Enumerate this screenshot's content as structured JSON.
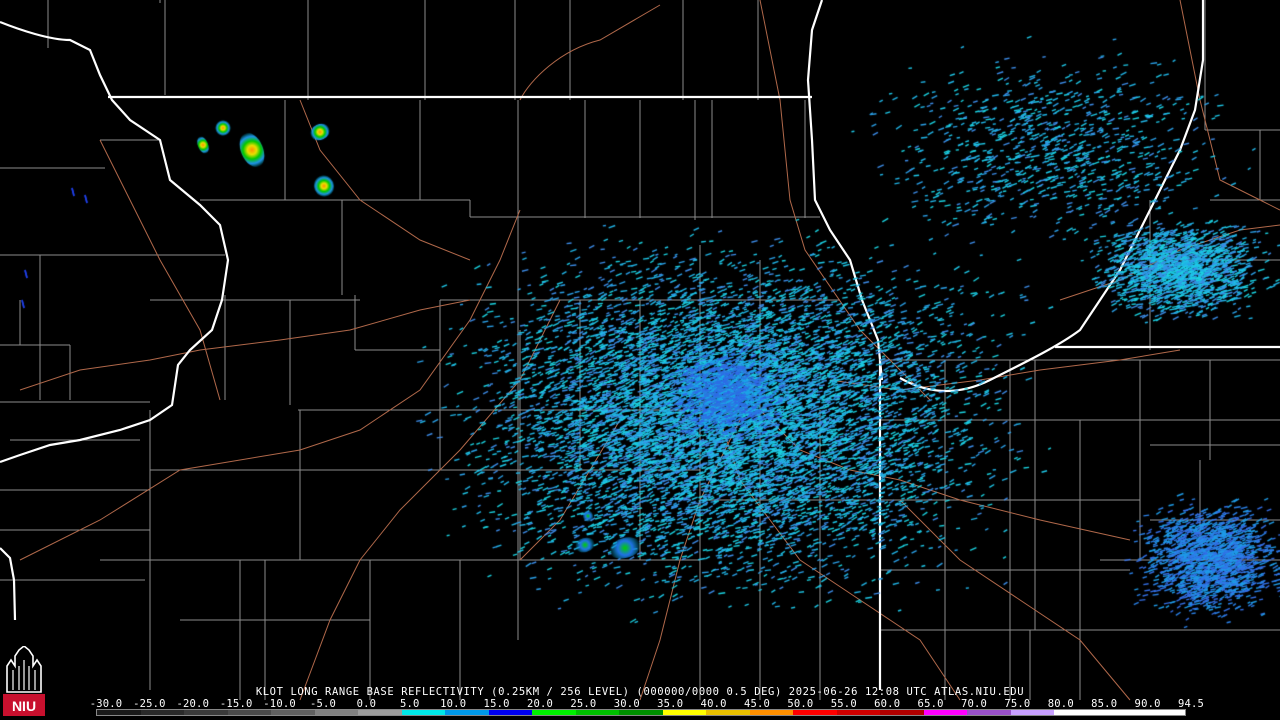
{
  "product": {
    "caption": "KLOT LONG RANGE BASE REFLECTIVITY (0.25KM / 256 LEVEL) (000000/0000 0.5 DEG) 2025-06-26 12:08 UTC  ATLAS.NIU.EDU"
  },
  "scale": {
    "labels": [
      "-30.0",
      "-25.0",
      "-20.0",
      "-15.0",
      "-10.0",
      "-5.0",
      "0.0",
      "5.0",
      "10.0",
      "15.0",
      "20.0",
      "25.0",
      "30.0",
      "35.0",
      "40.0",
      "45.0",
      "50.0",
      "55.0",
      "60.0",
      "65.0",
      "70.0",
      "75.0",
      "80.0",
      "85.0",
      "90.0",
      "94.5"
    ],
    "colors": [
      "#1a1a1a",
      "#2a2a2a",
      "#3a3a3a",
      "#4a4a4a",
      "#606060",
      "#808080",
      "#9c9c9c",
      "#00e8e8",
      "#0098e8",
      "#0000f0",
      "#00f000",
      "#00c000",
      "#009000",
      "#ffff00",
      "#e8c000",
      "#ff9000",
      "#ff0000",
      "#d00000",
      "#b00000",
      "#ff00ff",
      "#9850c8",
      "#c8a0ff",
      "#ffffff",
      "#ffffff",
      "#ffffff"
    ]
  },
  "logo": {
    "text": "NIU",
    "color": "#c8102e"
  },
  "map_colors": {
    "state_border": "#ffffff",
    "county_line": "#8c8c8c",
    "highway": "#b0684a",
    "radar_site": "#000000"
  }
}
